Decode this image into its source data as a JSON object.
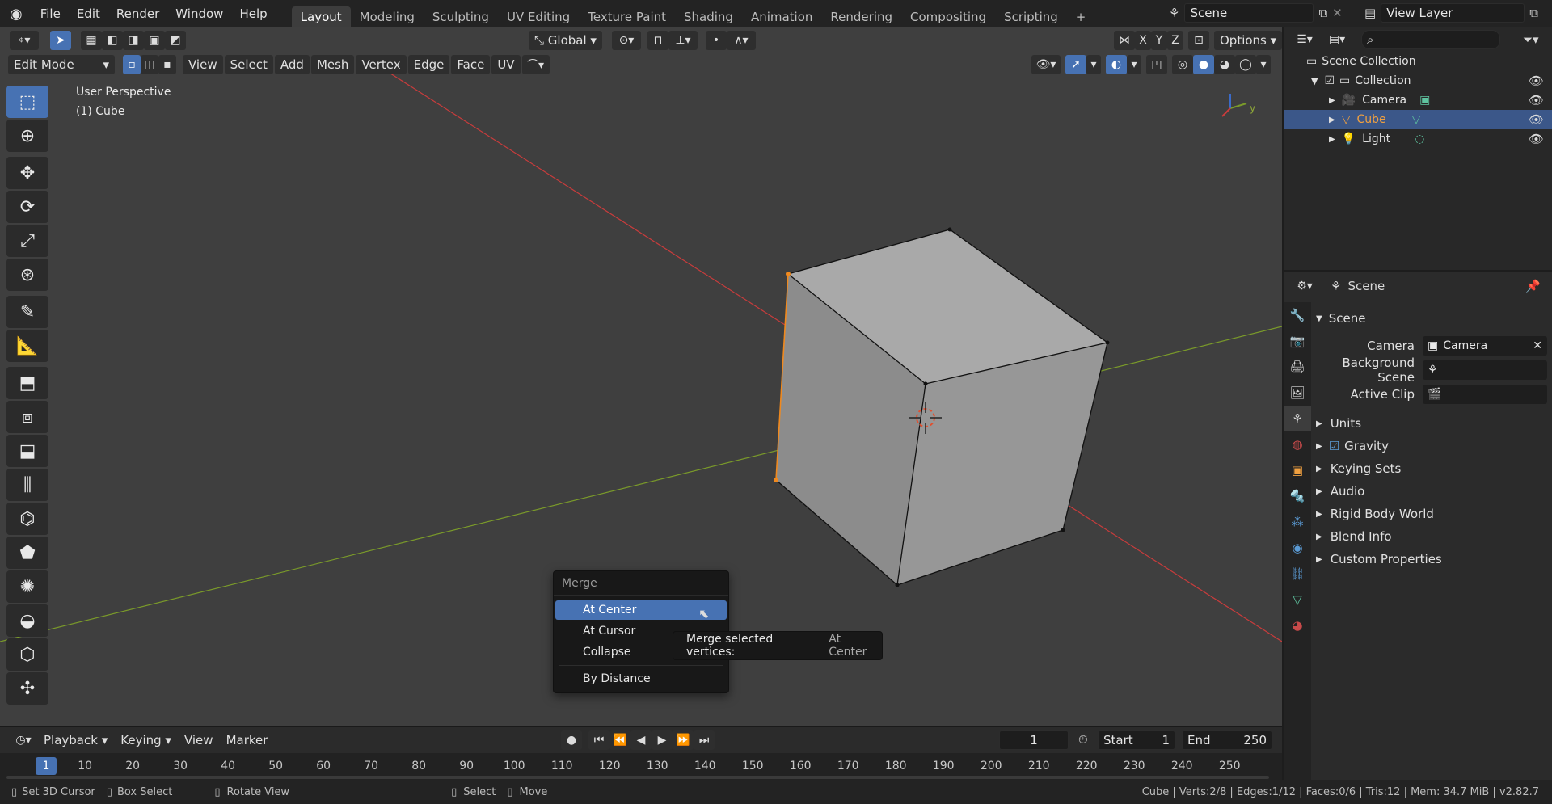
{
  "topbar": {
    "menus": [
      "File",
      "Edit",
      "Render",
      "Window",
      "Help"
    ],
    "workspaces": [
      "Layout",
      "Modeling",
      "Sculpting",
      "UV Editing",
      "Texture Paint",
      "Shading",
      "Animation",
      "Rendering",
      "Compositing",
      "Scripting"
    ],
    "active_workspace": "Layout",
    "scene_name": "Scene",
    "view_layer": "View Layer"
  },
  "viewport_header": {
    "transform_orientation": "Global",
    "axes": [
      "X",
      "Y",
      "Z"
    ],
    "options_label": "Options",
    "mode": "Edit Mode",
    "menus": [
      "View",
      "Select",
      "Add",
      "Mesh",
      "Vertex",
      "Edge",
      "Face",
      "UV"
    ]
  },
  "viewport": {
    "perspective_label": "User Perspective",
    "object_label": "(1) Cube",
    "gizmo_axis": "y"
  },
  "merge_menu": {
    "title": "Merge",
    "items": [
      "At Center",
      "At Cursor",
      "Collapse",
      "By Distance"
    ],
    "highlighted": "At Center"
  },
  "tooltip": {
    "text": "Merge selected vertices:",
    "value": "At Center"
  },
  "timeline": {
    "menus": [
      "Playback",
      "Keying",
      "View",
      "Marker"
    ],
    "current_frame": "1",
    "start_label": "Start",
    "start": "1",
    "end_label": "End",
    "end": "250",
    "ticks": [
      "1",
      "10",
      "20",
      "30",
      "40",
      "50",
      "60",
      "70",
      "80",
      "90",
      "100",
      "110",
      "120",
      "130",
      "140",
      "150",
      "160",
      "170",
      "180",
      "190",
      "200",
      "210",
      "220",
      "230",
      "240",
      "250"
    ]
  },
  "statusbar": {
    "hints": [
      "Set 3D Cursor",
      "Box Select",
      "Rotate View",
      "Select",
      "Move"
    ],
    "stats": "Cube | Verts:2/8 | Edges:1/12 | Faces:0/6 | Tris:12 | Mem: 34.7 MiB | v2.82.7"
  },
  "outliner": {
    "root": "Scene Collection",
    "collection": "Collection",
    "items": [
      "Camera",
      "Cube",
      "Light"
    ],
    "selected": "Cube"
  },
  "properties": {
    "header": "Scene",
    "section": "Scene",
    "fields": [
      {
        "label": "Camera",
        "value": "Camera"
      },
      {
        "label": "Background Scene",
        "value": ""
      },
      {
        "label": "Active Clip",
        "value": ""
      }
    ],
    "subsections": [
      "Units",
      "Gravity",
      "Keying Sets",
      "Audio",
      "Rigid Body World",
      "Blend Info",
      "Custom Properties"
    ]
  },
  "colors": {
    "accent": "#4772b3",
    "selection_orange": "#f0891e",
    "x_axis": "#c83c3c",
    "y_axis": "#7a9a2a"
  }
}
